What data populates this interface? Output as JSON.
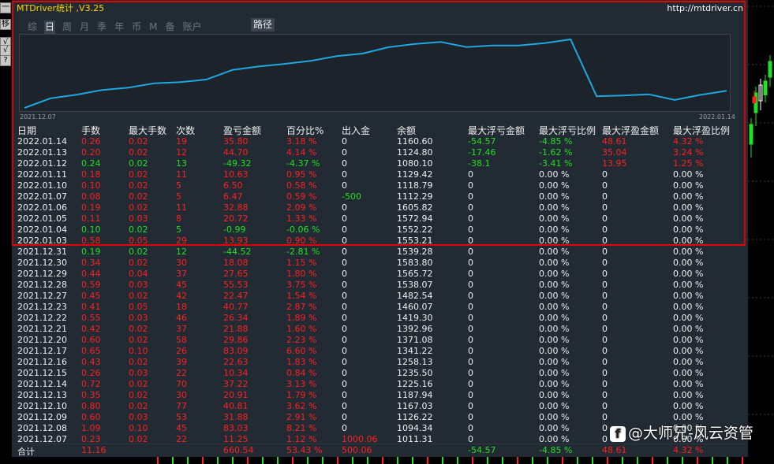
{
  "window": {
    "title": "MTDriver统计 ,V3.25",
    "url": "http://mtdriver.cn"
  },
  "side_buttons": [
    "一",
    "移",
    "√",
    "√",
    "?"
  ],
  "tabs": [
    {
      "label": "综",
      "active": false
    },
    {
      "label": "日",
      "active": true
    },
    {
      "label": "周",
      "active": false
    },
    {
      "label": "月",
      "active": false
    },
    {
      "label": "季",
      "active": false
    },
    {
      "label": "年",
      "active": false
    },
    {
      "label": "币",
      "active": false
    },
    {
      "label": "M",
      "active": false
    },
    {
      "label": "备",
      "active": false
    },
    {
      "label": "账户",
      "active": false
    }
  ],
  "path_button": "路径",
  "balance_chart": {
    "start_label": "2021.12.07",
    "end_label": "2022.01.14",
    "line_color": "#1fa8e0"
  },
  "table": {
    "headers": [
      "日期",
      "手数",
      "最大手数",
      "次数",
      "盈亏金额",
      "百分比%",
      "出入金",
      "余额",
      "最大浮亏金额",
      "最大浮亏比例",
      "最大浮盈金额",
      "最大浮盈比例"
    ],
    "rows": [
      [
        "2022.01.14",
        "0.26",
        "0.02",
        "19",
        "35.80",
        "3.18 %",
        "0",
        "1160.60",
        "-54.57",
        "-4.85 %",
        "48.61",
        "4.32 %"
      ],
      [
        "2022.01.13",
        "0.20",
        "0.02",
        "12",
        "44.70",
        "4.14 %",
        "0",
        "1124.80",
        "-17.46",
        "-1.62 %",
        "35.04",
        "3.24 %"
      ],
      [
        "2022.01.12",
        "0.24",
        "0.02",
        "13",
        "-49.32",
        "-4.37 %",
        "0",
        "1080.10",
        "-38.1",
        "-3.41 %",
        "13.95",
        "1.25 %"
      ],
      [
        "2022.01.11",
        "0.18",
        "0.02",
        "11",
        "10.63",
        "0.95 %",
        "0",
        "1129.42",
        "0",
        "0.00 %",
        "0",
        "0.00 %"
      ],
      [
        "2022.01.10",
        "0.10",
        "0.02",
        "5",
        "6.50",
        "0.58 %",
        "0",
        "1118.79",
        "0",
        "0.00 %",
        "0",
        "0.00 %"
      ],
      [
        "2022.01.07",
        "0.08",
        "0.02",
        "5",
        "6.47",
        "0.59 %",
        "-500",
        "1112.29",
        "0",
        "0.00 %",
        "0",
        "0.00 %"
      ],
      [
        "2022.01.06",
        "0.19",
        "0.02",
        "11",
        "32.88",
        "2.09 %",
        "0",
        "1605.82",
        "0",
        "0.00 %",
        "0",
        "0.00 %"
      ],
      [
        "2022.01.05",
        "0.11",
        "0.03",
        "8",
        "20.72",
        "1.33 %",
        "0",
        "1572.94",
        "0",
        "0.00 %",
        "0",
        "0.00 %"
      ],
      [
        "2022.01.04",
        "0.10",
        "0.02",
        "5",
        "-0.99",
        "-0.06 %",
        "0",
        "1552.22",
        "0",
        "0.00 %",
        "0",
        "0.00 %"
      ],
      [
        "2022.01.03",
        "0.58",
        "0.05",
        "29",
        "13.93",
        "0.90 %",
        "0",
        "1553.21",
        "0",
        "0.00 %",
        "0",
        "0.00 %"
      ],
      [
        "2021.12.31",
        "0.19",
        "0.02",
        "12",
        "-44.52",
        "-2.81 %",
        "0",
        "1539.28",
        "0",
        "0.00 %",
        "0",
        "0.00 %"
      ],
      [
        "2021.12.30",
        "0.34",
        "0.02",
        "30",
        "18.08",
        "1.15 %",
        "0",
        "1583.80",
        "0",
        "0.00 %",
        "0",
        "0.00 %"
      ],
      [
        "2021.12.29",
        "0.44",
        "0.04",
        "37",
        "27.65",
        "1.80 %",
        "0",
        "1565.72",
        "0",
        "0.00 %",
        "0",
        "0.00 %"
      ],
      [
        "2021.12.28",
        "0.59",
        "0.03",
        "45",
        "55.53",
        "3.75 %",
        "0",
        "1538.07",
        "0",
        "0.00 %",
        "0",
        "0.00 %"
      ],
      [
        "2021.12.27",
        "0.45",
        "0.02",
        "42",
        "22.47",
        "1.54 %",
        "0",
        "1482.54",
        "0",
        "0.00 %",
        "0",
        "0.00 %"
      ],
      [
        "2021.12.23",
        "0.41",
        "0.05",
        "18",
        "40.77",
        "2.87 %",
        "0",
        "1460.07",
        "0",
        "0.00 %",
        "0",
        "0.00 %"
      ],
      [
        "2021.12.22",
        "0.55",
        "0.03",
        "46",
        "26.34",
        "1.89 %",
        "0",
        "1419.30",
        "0",
        "0.00 %",
        "0",
        "0.00 %"
      ],
      [
        "2021.12.21",
        "0.42",
        "0.02",
        "37",
        "21.88",
        "1.60 %",
        "0",
        "1392.96",
        "0",
        "0.00 %",
        "0",
        "0.00 %"
      ],
      [
        "2021.12.20",
        "0.60",
        "0.02",
        "58",
        "29.86",
        "2.23 %",
        "0",
        "1371.08",
        "0",
        "0.00 %",
        "0",
        "0.00 %"
      ],
      [
        "2021.12.17",
        "0.65",
        "0.10",
        "26",
        "83.09",
        "6.60 %",
        "0",
        "1341.22",
        "0",
        "0.00 %",
        "0",
        "0.00 %"
      ],
      [
        "2021.12.16",
        "0.43",
        "0.02",
        "39",
        "22.63",
        "1.83 %",
        "0",
        "1258.13",
        "0",
        "0.00 %",
        "0",
        "0.00 %"
      ],
      [
        "2021.12.15",
        "0.26",
        "0.03",
        "22",
        "10.34",
        "0.84 %",
        "0",
        "1235.50",
        "0",
        "0.00 %",
        "0",
        "0.00 %"
      ],
      [
        "2021.12.14",
        "0.72",
        "0.02",
        "70",
        "37.22",
        "3.13 %",
        "0",
        "1225.16",
        "0",
        "0.00 %",
        "0",
        "0.00 %"
      ],
      [
        "2021.12.13",
        "0.35",
        "0.02",
        "30",
        "20.91",
        "1.79 %",
        "0",
        "1187.94",
        "0",
        "0.00 %",
        "0",
        "0.00 %"
      ],
      [
        "2021.12.10",
        "0.80",
        "0.02",
        "77",
        "40.81",
        "3.62 %",
        "0",
        "1167.03",
        "0",
        "0.00 %",
        "0",
        "0.00 %"
      ],
      [
        "2021.12.09",
        "0.60",
        "0.03",
        "53",
        "31.88",
        "2.91 %",
        "0",
        "1126.22",
        "0",
        "0.00 %",
        "0",
        "0.00 %"
      ],
      [
        "2021.12.08",
        "1.09",
        "0.10",
        "45",
        "83.03",
        "8.21 %",
        "0",
        "1094.34",
        "0",
        "0.00 %",
        "0",
        "0.00 %"
      ],
      [
        "2021.12.07",
        "0.23",
        "0.02",
        "22",
        "11.25",
        "1.12 %",
        "1000.06",
        "1011.31",
        "0",
        "0.00 %",
        "0",
        "0.00 %"
      ]
    ],
    "total": [
      "合计",
      "11.16",
      "",
      "",
      "660.54",
      "53.43 %",
      "500.06",
      "",
      "-54.57",
      "-4.85 %",
      "48.61",
      "4.32 %"
    ]
  },
  "watermark": {
    "icon": "f",
    "text": "@大师兄-风云资管"
  },
  "colors": {
    "positive": "#ff2020",
    "negative": "#22e022",
    "title": "#ffd400",
    "frame": "#e00000"
  }
}
